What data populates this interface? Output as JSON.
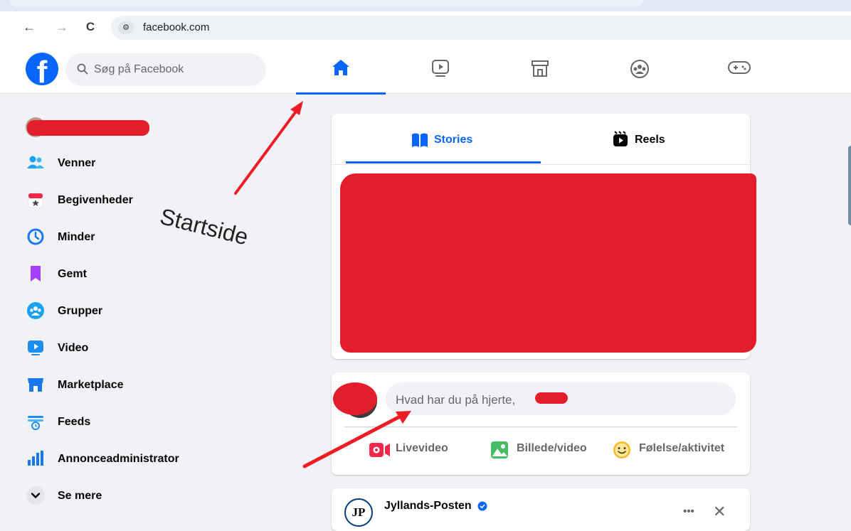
{
  "browser": {
    "url": "facebook.com",
    "back_icon": "←",
    "forward_icon": "→",
    "reload_icon": "C",
    "site_settings_icon": "tune-icon"
  },
  "header": {
    "logo": "f",
    "search_placeholder": "Søg på Facebook",
    "nav_icons": [
      "home-icon",
      "video-icon",
      "marketplace-icon",
      "groups-icon",
      "gaming-icon"
    ],
    "active_nav": "home"
  },
  "sidebar": {
    "items": [
      {
        "label": "Venner",
        "icon": "friends-icon"
      },
      {
        "label": "Begivenheder",
        "icon": "calendar-icon"
      },
      {
        "label": "Minder",
        "icon": "memories-icon"
      },
      {
        "label": "Gemt",
        "icon": "bookmark-icon"
      },
      {
        "label": "Grupper",
        "icon": "groups-icon"
      },
      {
        "label": "Video",
        "icon": "video-icon"
      },
      {
        "label": "Marketplace",
        "icon": "marketplace-icon"
      },
      {
        "label": "Feeds",
        "icon": "feeds-icon"
      },
      {
        "label": "Annonceadministrator",
        "icon": "ads-icon"
      },
      {
        "label": "Se mere",
        "icon": "chevron-down-icon"
      }
    ]
  },
  "annotation": {
    "text": "Startside"
  },
  "stories": {
    "tabs": [
      {
        "label": "Stories",
        "icon": "book-icon",
        "active": true
      },
      {
        "label": "Reels",
        "icon": "reels-icon",
        "active": false
      }
    ]
  },
  "composer": {
    "placeholder": "Hvad har du på hjerte,",
    "placeholder_end": "?",
    "actions": [
      {
        "label": "Livevideo",
        "icon": "live-video-icon",
        "color": "#f02849"
      },
      {
        "label": "Billede/video",
        "icon": "photo-icon",
        "color": "#45bd62"
      },
      {
        "label": "Følelse/aktivitet",
        "icon": "feeling-icon",
        "color": "#f7b928"
      }
    ]
  },
  "post": {
    "author": "Jyllands-Posten",
    "avatar_text": "JP",
    "verified": true,
    "more_icon": "•••",
    "close_icon": "✕"
  },
  "colors": {
    "accent": "#0866ff",
    "redaction": "#e41d2d",
    "arrow": "#ee1c24"
  }
}
